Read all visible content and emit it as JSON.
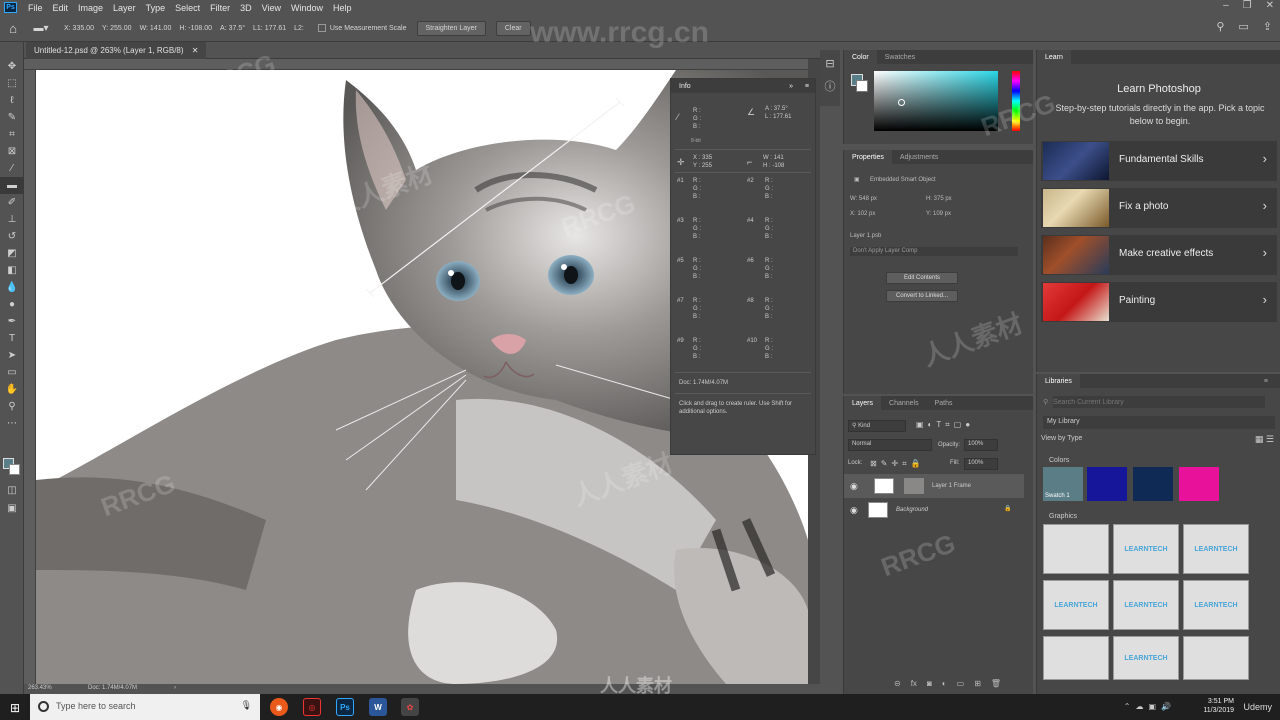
{
  "menu": [
    "File",
    "Edit",
    "Image",
    "Layer",
    "Type",
    "Select",
    "Filter",
    "3D",
    "View",
    "Window",
    "Help"
  ],
  "app_logo": "Ps",
  "options": {
    "x": "X: 335.00",
    "y": "Y: 255.00",
    "w": "W: 141.00",
    "h": "H: -108.00",
    "a": "A: 37.5°",
    "l1": "L1: 177.61",
    "l2": "L2:",
    "measure_scale": "Use Measurement Scale",
    "straighten": "Straighten Layer",
    "clear": "Clear"
  },
  "doc_tab": "Untitled-12.psd @ 263% (Layer 1, RGB/8)",
  "status": {
    "zoom": "263.43%",
    "doc": "Doc: 1.74M/4.07M"
  },
  "info": {
    "title": "Info",
    "rgb1": [
      "R :",
      "G :",
      "B :"
    ],
    "bit_label": "8-bit",
    "angle": [
      "A :",
      "37.5°"
    ],
    "length": [
      "L :",
      "177.61"
    ],
    "xy": [
      "X :",
      "335",
      "Y :",
      "255"
    ],
    "wh": [
      "W :",
      "141",
      "H :",
      "-108"
    ],
    "samplers": [
      "#1",
      "#2",
      "#3",
      "#4",
      "#5",
      "#6",
      "#7",
      "#8",
      "#9",
      "#10"
    ],
    "doc": "Doc: 1.74M/4.07M",
    "hint": "Click and drag to create ruler. Use Shift for additional options."
  },
  "color_panel": {
    "tabs": [
      "Color",
      "Swatches"
    ]
  },
  "properties": {
    "tabs": [
      "Properties",
      "Adjustments"
    ],
    "type": "Embedded Smart Object",
    "w": "W: 548 px",
    "h": "H: 375 px",
    "x": "X: 102 px",
    "y": "Y: 109 px",
    "file": "Layer 1.psb",
    "comp": "Don't Apply Layer Comp",
    "edit_btn": "Edit Contents",
    "convert_btn": "Convert to Linked..."
  },
  "layers_panel": {
    "tabs": [
      "Layers",
      "Channels",
      "Paths"
    ],
    "kind": "Kind",
    "blend": "Normal",
    "opacity_label": "Opacity:",
    "opacity": "100%",
    "lock_label": "Lock:",
    "fill_label": "Fill:",
    "fill": "100%",
    "layers": [
      {
        "name": "Layer 1 Frame"
      },
      {
        "name": "Background"
      }
    ]
  },
  "learn": {
    "tab": "Learn",
    "title": "Learn Photoshop",
    "subtitle": "Step-by-step tutorials directly in the app. Pick a topic below to begin.",
    "cards": [
      "Fundamental Skills",
      "Fix a photo",
      "Make creative effects",
      "Painting"
    ]
  },
  "libraries": {
    "tab": "Libraries",
    "search_placeholder": "Search Current Library",
    "library": "My Library",
    "view": "View by Type",
    "colors_label": "Colors",
    "swatch_label": "Swatch 1",
    "swatches": [
      "#5b7d86",
      "#16169a",
      "#0e2a55",
      "#e8129a"
    ],
    "graphics_label": "Graphics",
    "graphic_text": "LEARNTECH"
  },
  "taskbar": {
    "search": "Type here to search",
    "time": "3:51 PM",
    "date": "11/3/2019",
    "udemy": "Udemy"
  },
  "watermark": {
    "site": "www.rrcg.cn",
    "mark": "RRCG",
    "cn": "人人素材"
  }
}
